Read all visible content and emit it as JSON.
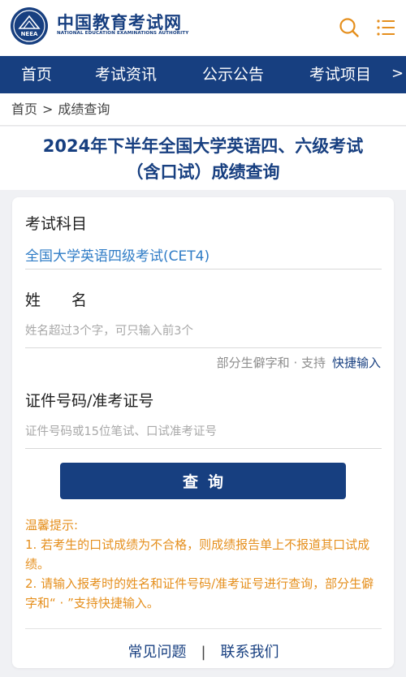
{
  "header": {
    "logo_title": "中国教育考试网",
    "logo_subtitle": "NATIONAL EDUCATION EXAMINATIONS AUTHORITY",
    "logo_emblem_text": "NEEA",
    "brand_color": "#173f80",
    "accent_color": "#e58f1d",
    "icons": [
      "search-icon",
      "menu-icon"
    ]
  },
  "nav": {
    "items": [
      {
        "label": "首页"
      },
      {
        "label": "考试资讯"
      },
      {
        "label": "公示公告"
      },
      {
        "label": "考试项目"
      }
    ],
    "more_arrow": ">"
  },
  "breadcrumb": {
    "home": "首页",
    "separator": ">",
    "current": "成绩查询"
  },
  "page_title": {
    "line1": "2024年下半年全国大学英语四、六级考试",
    "line2": "（含口试）成绩查询"
  },
  "form": {
    "subject_label": "考试科目",
    "subject_value": "全国大学英语四级考试(CET4)",
    "name_label": "姓　　名",
    "name_placeholder": "姓名超过3个字，可只输入前3个",
    "name_hint_text": "部分生僻字和 · 支持",
    "name_hint_link": "快捷输入",
    "id_label": "证件号码/准考证号",
    "id_placeholder": "证件号码或15位笔试、口试准考证号",
    "submit_label": "查询"
  },
  "tips": {
    "title": "温馨提示:",
    "items": [
      "1. 若考生的口试成绩为不合格，则成绩报告单上不报道其口试成绩。",
      "2. 请输入报考时的姓名和证件号码/准考证号进行查询，部分生僻字和“ · ”支持快捷输入。"
    ]
  },
  "footer": {
    "faq": "常见问题",
    "divider": "|",
    "contact": "联系我们"
  }
}
